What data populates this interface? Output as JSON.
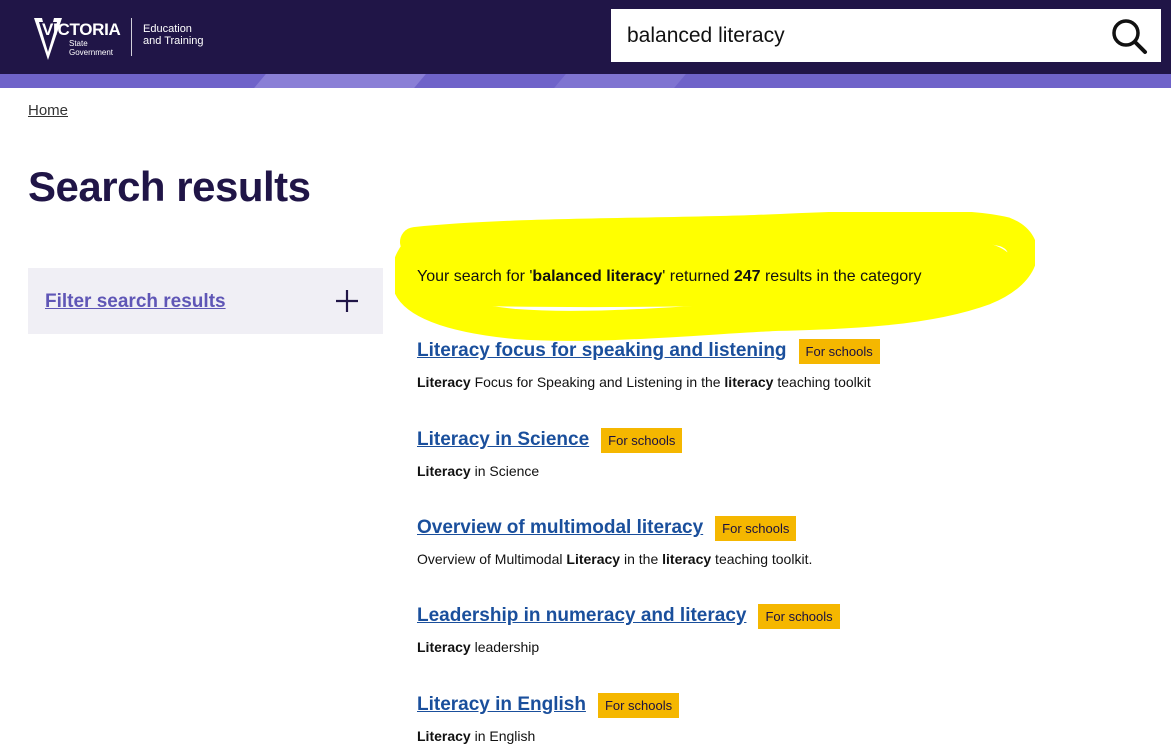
{
  "header": {
    "logo": {
      "wordmark": "VICTORIA",
      "state_line1": "State",
      "state_line2": "Government",
      "dept_line1": "Education",
      "dept_line2": "and Training"
    },
    "search": {
      "value": "balanced literacy",
      "icon": "search-icon"
    }
  },
  "breadcrumb": {
    "home": "Home"
  },
  "page_title": "Search results",
  "filter": {
    "label": "Filter search results",
    "icon": "plus-icon"
  },
  "summary": {
    "prefix": "Your search for '",
    "query": "balanced literacy",
    "mid": "' returned ",
    "count": "247",
    "suffix": " results in the category"
  },
  "highlight_color": "#ffff00",
  "badge_color": "#f5b700",
  "results": [
    {
      "title": "Literacy focus for speaking and listening",
      "badge": "For schools",
      "desc": [
        {
          "text": "Literacy",
          "bold": true
        },
        {
          "text": " Focus for Speaking and Listening in the ",
          "bold": false
        },
        {
          "text": "literacy",
          "bold": true
        },
        {
          "text": " teaching toolkit",
          "bold": false
        }
      ]
    },
    {
      "title": "Literacy in Science",
      "badge": "For schools",
      "desc": [
        {
          "text": "Literacy",
          "bold": true
        },
        {
          "text": " in Science",
          "bold": false
        }
      ]
    },
    {
      "title": "Overview of multimodal literacy",
      "badge": "For schools",
      "desc": [
        {
          "text": "Overview of Multimodal ",
          "bold": false
        },
        {
          "text": "Literacy",
          "bold": true
        },
        {
          "text": " in the ",
          "bold": false
        },
        {
          "text": "literacy",
          "bold": true
        },
        {
          "text": " teaching toolkit.",
          "bold": false
        }
      ]
    },
    {
      "title": "Leadership in numeracy and literacy",
      "badge": "For schools",
      "desc": [
        {
          "text": "Literacy",
          "bold": true
        },
        {
          "text": " leadership",
          "bold": false
        }
      ]
    },
    {
      "title": "Literacy in English",
      "badge": "For schools",
      "desc": [
        {
          "text": "Literacy",
          "bold": true
        },
        {
          "text": " in English",
          "bold": false
        }
      ]
    }
  ]
}
